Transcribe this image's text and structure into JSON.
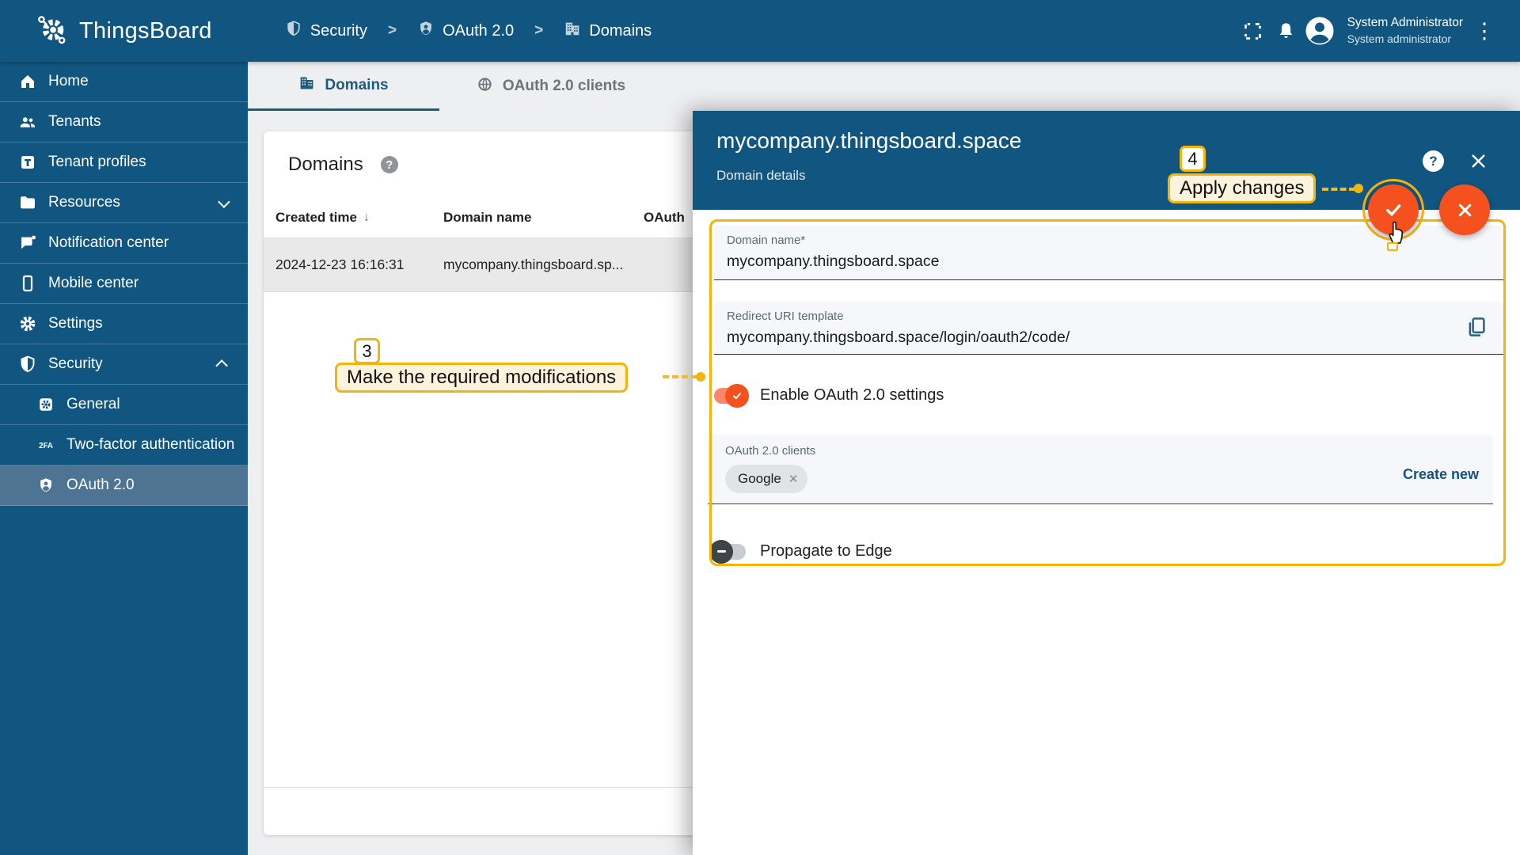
{
  "colors": {
    "primary": "#115680",
    "sidebar-selected": "#4d7493",
    "accent-yellow": "#f2b50e",
    "callout-bg": "#fcf3dc",
    "fab-orange": "#f4511e",
    "page-bg": "#edeff1",
    "field-bg": "#f5f7fa",
    "link-blue": "#15537e"
  },
  "app": {
    "title": "ThingsBoard"
  },
  "header": {
    "breadcrumb": [
      {
        "label": "Security"
      },
      {
        "label": "OAuth 2.0"
      },
      {
        "label": "Domains"
      }
    ],
    "user": {
      "name": "System Administrator",
      "role": "System administrator"
    }
  },
  "sidebar": {
    "items": [
      {
        "label": "Home"
      },
      {
        "label": "Tenants"
      },
      {
        "label": "Tenant profiles"
      },
      {
        "label": "Resources"
      },
      {
        "label": "Notification center"
      },
      {
        "label": "Mobile center"
      },
      {
        "label": "Settings"
      },
      {
        "label": "Security"
      },
      {
        "label": "General"
      },
      {
        "label": "Two-factor authentication"
      },
      {
        "label": "OAuth 2.0"
      }
    ]
  },
  "tabs": [
    {
      "label": "Domains"
    },
    {
      "label": "OAuth 2.0 clients"
    }
  ],
  "table": {
    "title": "Domains",
    "columns": [
      "Created time",
      "Domain name",
      "OAuth"
    ],
    "rows": [
      {
        "created_time": "2024-12-23 16:16:31",
        "domain_name": "mycompany.thingsboard.sp..."
      }
    ]
  },
  "panel": {
    "title": "mycompany.thingsboard.space",
    "subtitle": "Domain details",
    "fields": {
      "domain_name": {
        "label": "Domain name*",
        "value": "mycompany.thingsboard.space"
      },
      "redirect_uri": {
        "label": "Redirect URI template",
        "value": "mycompany.thingsboard.space/login/oauth2/code/"
      }
    },
    "toggles": {
      "oauth_enabled": {
        "label": "Enable OAuth 2.0 settings",
        "state": "on"
      },
      "propagate_edge": {
        "label": "Propagate to Edge",
        "state": "off"
      }
    },
    "clients": {
      "label": "OAuth 2.0 clients",
      "chips": [
        {
          "label": "Google"
        }
      ],
      "action": "Create new"
    }
  },
  "annotations": {
    "step3": {
      "number": "3",
      "label": "Make the required modifications"
    },
    "step4": {
      "number": "4",
      "label": "Apply changes"
    }
  }
}
